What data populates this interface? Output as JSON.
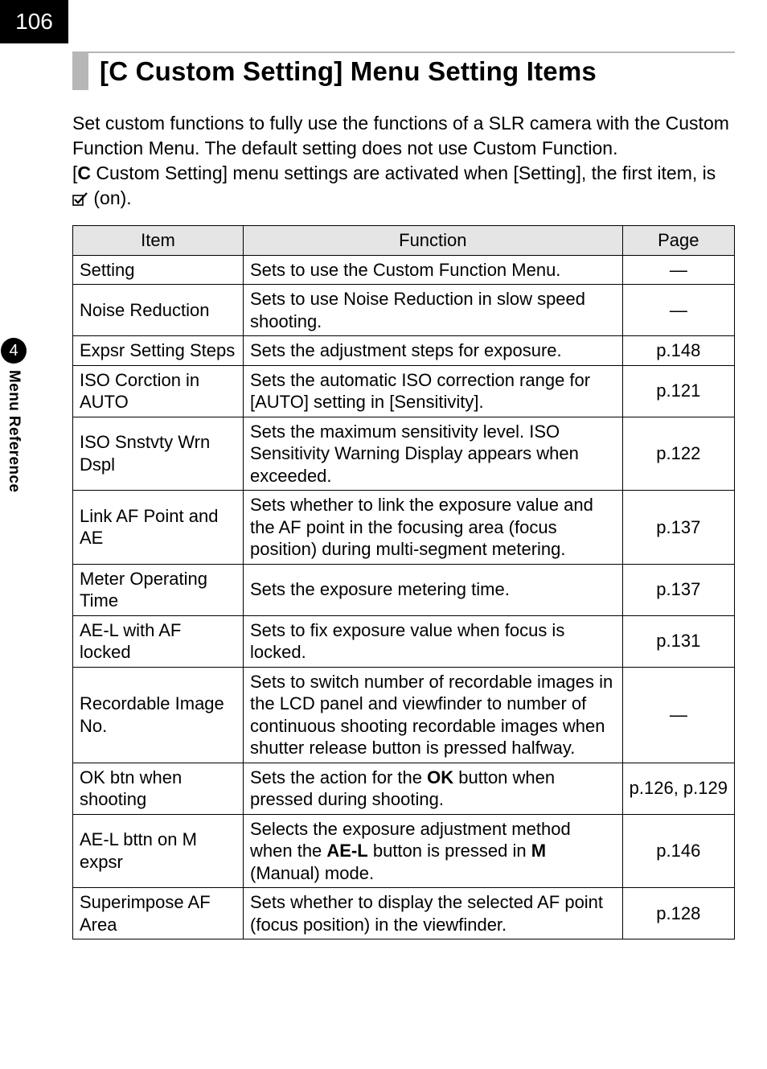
{
  "page_number": "106",
  "side_tab": {
    "chapter_number": "4",
    "label": "Menu Reference"
  },
  "heading": {
    "icon": "C",
    "title_rest": " Custom Setting] Menu Setting Items",
    "title_prefix": "["
  },
  "intro": {
    "p1": "Set custom functions to fully use the functions of a SLR camera with the Custom Function Menu. The default setting does not use Custom Function.",
    "p2_prefix": "[",
    "p2_icon": "C",
    "p2_mid": " Custom Setting] menu settings are activated when [Setting], the first item, is ",
    "p2_suffix": " (on)."
  },
  "table": {
    "headers": {
      "item": "Item",
      "function": "Function",
      "page": "Page"
    },
    "rows": [
      {
        "item": "Setting",
        "function": "Sets to use the Custom Function Menu.",
        "page": "—"
      },
      {
        "item": "Noise Reduction",
        "function": "Sets to use Noise Reduction in slow speed shooting.",
        "page": "—"
      },
      {
        "item": "Expsr Setting Steps",
        "function": "Sets the adjustment steps for exposure.",
        "page": "p.148"
      },
      {
        "item": "ISO Corction in AUTO",
        "function": "Sets the automatic ISO correction range for [AUTO] setting in [Sensitivity].",
        "page": "p.121"
      },
      {
        "item": "ISO Snstvty Wrn Dspl",
        "function": "Sets the maximum sensitivity level. ISO Sensitivity Warning Display appears when exceeded.",
        "page": "p.122"
      },
      {
        "item": "Link AF Point and AE",
        "function": "Sets whether to link the exposure value and the AF point in the focusing area (focus position) during multi-segment metering.",
        "page": "p.137"
      },
      {
        "item": "Meter Operating Time",
        "function": "Sets the exposure metering time.",
        "page": "p.137"
      },
      {
        "item": "AE-L with AF locked",
        "function": "Sets to fix exposure value when focus is locked.",
        "page": "p.131"
      },
      {
        "item": "Recordable Image No.",
        "function": "Sets to switch number of recordable images in the LCD panel and viewfinder to number of continuous shooting recordable images when shutter release button is pressed halfway.",
        "page": "—"
      },
      {
        "item": "OK btn when shooting",
        "function_pre": "Sets the action for the ",
        "function_bold": "OK",
        "function_post": " button when pressed during shooting.",
        "page": "p.126, p.129"
      },
      {
        "item": "AE-L bttn on M expsr",
        "function_pre": "Selects the exposure adjustment method when the ",
        "function_bold": "AE-L",
        "function_mid": " button is pressed in ",
        "function_bold2": "M",
        "function_post": " (Manual) mode.",
        "page": "p.146"
      },
      {
        "item": "Superimpose AF Area",
        "function": "Sets whether to display the selected AF point (focus position) in the viewfinder.",
        "page": "p.128"
      }
    ]
  }
}
